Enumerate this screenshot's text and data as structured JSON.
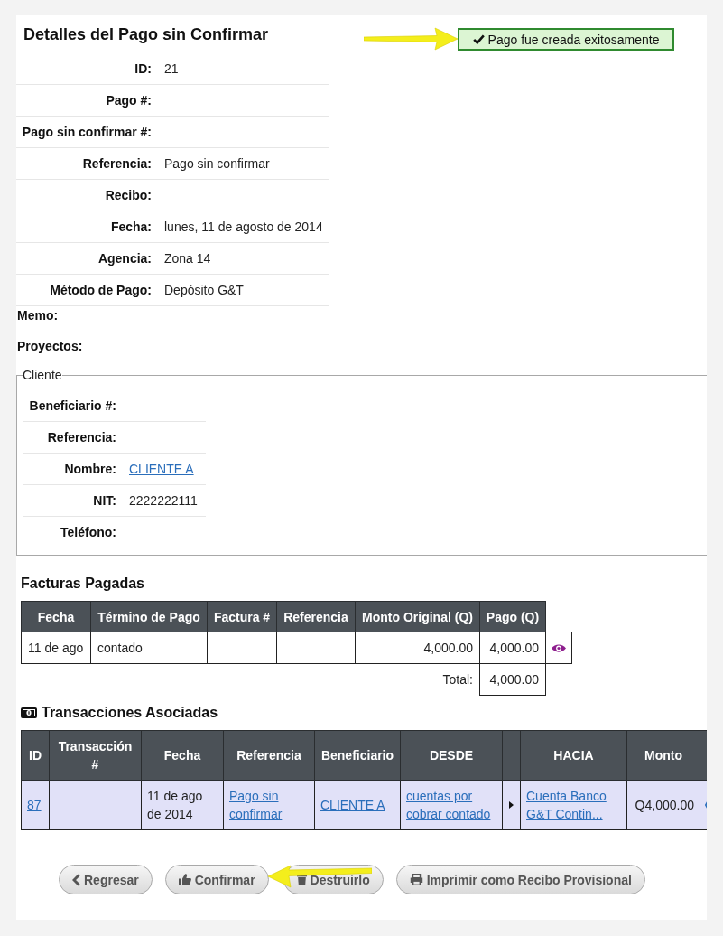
{
  "header": {
    "title": "Detalles del Pago sin Confirmar"
  },
  "alert": {
    "kind": "success",
    "text": "Pago fue creada exitosamente"
  },
  "details": [
    {
      "label": "ID:",
      "value": "21"
    },
    {
      "label": "Pago #:"
    },
    {
      "label": "Pago sin confirmar #:"
    },
    {
      "label": "Referencia:",
      "value": "Pago sin confirmar"
    },
    {
      "label": "Recibo:"
    },
    {
      "label": "Fecha:",
      "value": "lunes, 11 de agosto de 2014"
    },
    {
      "label": "Agencia:",
      "value": "Zona 14"
    },
    {
      "label": "Método de Pago:",
      "value": "Depósito G&T"
    }
  ],
  "extra_fields": [
    {
      "label": "Memo:"
    },
    {
      "label": "Proyectos:"
    }
  ],
  "client": {
    "legend": "Cliente",
    "fields": [
      {
        "kind": "text",
        "label": "Beneficiario #:"
      },
      {
        "kind": "text",
        "label": "Referencia:"
      },
      {
        "kind": "link",
        "label": "Nombre:",
        "value": "CLIENTE A"
      },
      {
        "kind": "text",
        "label": "NIT:",
        "value": "2222222111"
      },
      {
        "kind": "text",
        "label": "Teléfono:"
      }
    ]
  },
  "invoices": {
    "title": "Facturas Pagadas",
    "columns": [
      "Fecha",
      "Término de Pago",
      "Factura #",
      "Referencia",
      "Monto Original (Q)",
      "Pago (Q)"
    ],
    "rows": [
      {
        "date": "11 de ago",
        "payment_term": "contado",
        "original_amount": "4,000.00",
        "payment": "4,000.00"
      }
    ],
    "total": {
      "label": "Total:",
      "value": "4,000.00"
    }
  },
  "transactions": {
    "title": "Transacciones Asociadas",
    "columns": [
      {
        "kind": "text",
        "label": "ID"
      },
      {
        "kind": "text",
        "label": "Transacción #"
      },
      {
        "kind": "text",
        "label": "Fecha"
      },
      {
        "kind": "text",
        "label": "Referencia"
      },
      {
        "kind": "text",
        "label": "Beneficiario"
      },
      {
        "kind": "text",
        "label": "DESDE"
      },
      {
        "kind": "arrow"
      },
      {
        "kind": "text",
        "label": "HACIA"
      },
      {
        "kind": "text",
        "label": "Monto"
      },
      {
        "kind": "actions"
      }
    ],
    "rows": [
      {
        "id": "87",
        "date": "11 de ago de 2014",
        "reference": "Pago sin confirmar",
        "beneficiary": "CLIENTE A",
        "from": "cuentas por cobrar contado",
        "to": "Cuenta Banco G&T Contin...",
        "amount": "Q4,000.00"
      }
    ]
  },
  "buttons": [
    {
      "kind": "back",
      "label": "Regresar"
    },
    {
      "kind": "confirm",
      "label": "Confirmar"
    },
    {
      "kind": "delete",
      "label": "Destruirlo"
    },
    {
      "kind": "print",
      "label": "Imprimir como Recibo Provisional"
    }
  ]
}
